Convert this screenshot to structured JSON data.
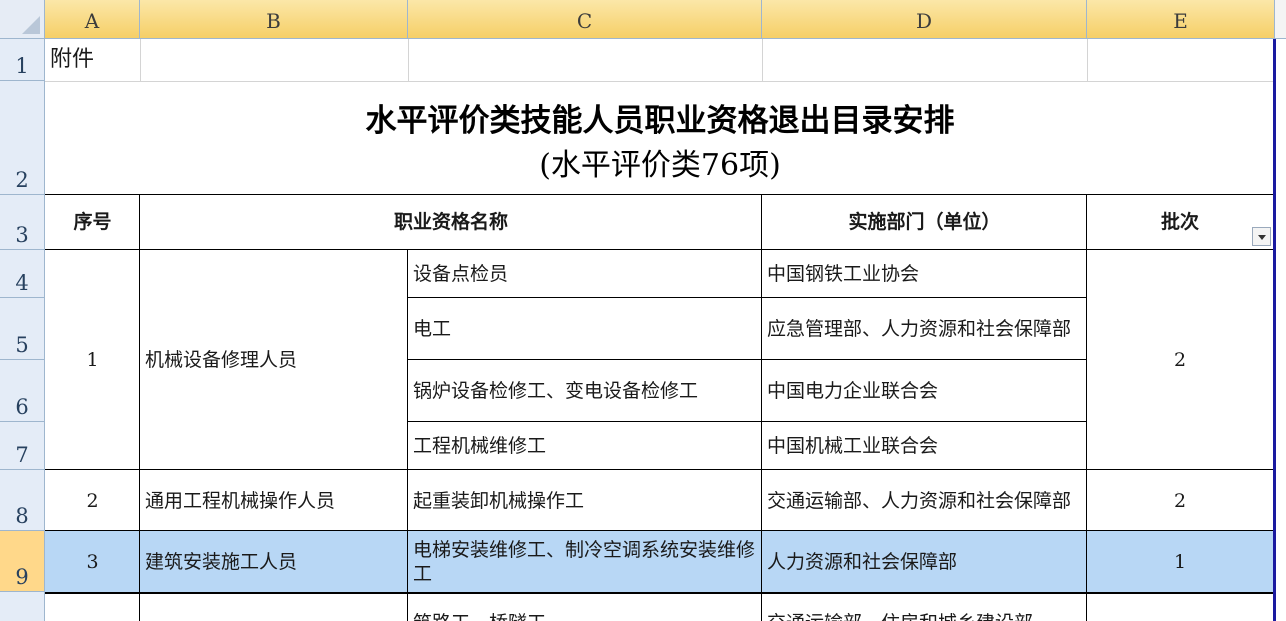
{
  "sheet": {
    "columns": [
      "A",
      "B",
      "C",
      "D",
      "E"
    ],
    "rows": [
      "1",
      "2",
      "3",
      "4",
      "5",
      "6",
      "7",
      "8",
      "9"
    ],
    "a1": "附件",
    "title": "水平评价类技能人员职业资格退出目录安排",
    "subtitle": "(水平评价类76项)",
    "headers": {
      "seq": "序号",
      "name": "职业资格名称",
      "dept": "实施部门（单位）",
      "batch": "批次"
    },
    "groups": [
      {
        "seq": "1",
        "category": "机械设备修理人员",
        "batch": "2",
        "items": [
          {
            "name": "设备点检员",
            "dept": "中国钢铁工业协会"
          },
          {
            "name": "电工",
            "dept": "应急管理部、人力资源和社会保障部"
          },
          {
            "name": "锅炉设备检修工、变电设备检修工",
            "dept": "中国电力企业联合会"
          },
          {
            "name": "工程机械维修工",
            "dept": "中国机械工业联合会"
          }
        ]
      },
      {
        "seq": "2",
        "category": "通用工程机械操作人员",
        "batch": "2",
        "items": [
          {
            "name": "起重装卸机械操作工",
            "dept": "交通运输部、人力资源和社会保障部"
          }
        ]
      },
      {
        "seq": "3",
        "category": "建筑安装施工人员",
        "batch": "1",
        "items": [
          {
            "name": "电梯安装维修工、制冷空调系统安装维修工",
            "dept": "人力资源和社会保障部"
          }
        ]
      }
    ],
    "partial_row": {
      "name": "筑路工、桥隧工",
      "dept": "交通运输部、住房和城乡建设部"
    }
  },
  "colors": {
    "selection": "#b8d7f5",
    "header_highlight": "#f6cf67",
    "row_header": "#e4ecf7"
  }
}
